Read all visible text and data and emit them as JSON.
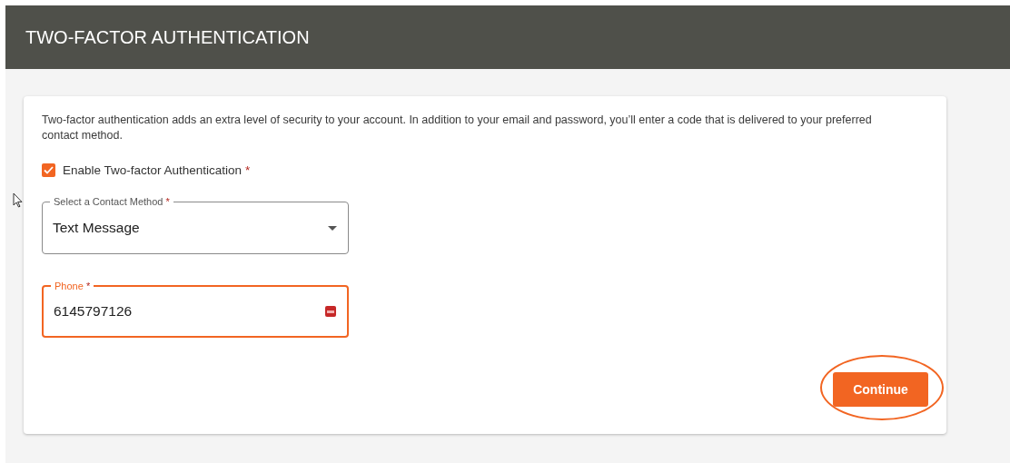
{
  "header": {
    "title": "TWO-FACTOR AUTHENTICATION"
  },
  "card": {
    "description": "Two-factor authentication adds an extra level of security to your account. In addition to your email and password, you’ll enter a code that is delivered to your preferred contact method.",
    "enable": {
      "label": "Enable Two-factor Authentication",
      "required_mark": "*",
      "checked": true
    },
    "contact_method": {
      "label": "Select a Contact Method",
      "required_mark": "*",
      "value": "Text Message",
      "focused": false
    },
    "phone": {
      "label": "Phone",
      "required_mark": "*",
      "value": "6145797126",
      "focused": true
    },
    "continue_button": {
      "label": "Continue",
      "highlighted": true
    }
  }
}
